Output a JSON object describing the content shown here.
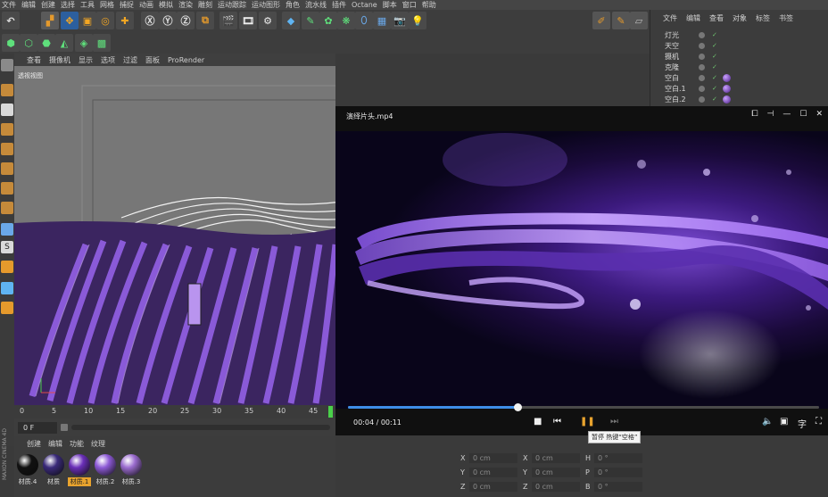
{
  "menu": [
    "文件",
    "编辑",
    "创建",
    "选择",
    "工具",
    "网格",
    "捕捉",
    "动画",
    "模拟",
    "渲染",
    "雕刻",
    "运动跟踪",
    "运动图形",
    "角色",
    "流水线",
    "插件",
    "Octane",
    "脚本",
    "窗口",
    "帮助"
  ],
  "object_manager": {
    "tabs": [
      "文件",
      "编辑",
      "查看",
      "对象",
      "标签",
      "书签"
    ],
    "rows": [
      {
        "name": "灯光"
      },
      {
        "name": "天空"
      },
      {
        "name": "摄机"
      },
      {
        "name": "克隆"
      },
      {
        "name": "空白"
      },
      {
        "name": "空白.1"
      },
      {
        "name": "空白.2"
      }
    ]
  },
  "viewport": {
    "menu": [
      "查看",
      "摄像机",
      "显示",
      "选项",
      "过滤",
      "面板",
      "ProRender"
    ],
    "label": "透视视图"
  },
  "timeline": {
    "ticks": [
      "0",
      "5",
      "10",
      "15",
      "20",
      "25",
      "30",
      "35",
      "40",
      "45"
    ],
    "frame": "0 F"
  },
  "material_manager": {
    "tabs": [
      "创建",
      "编辑",
      "功能",
      "纹理"
    ],
    "materials": [
      {
        "label": "材质.4",
        "color": "#111111"
      },
      {
        "label": "材质",
        "color": "#3a2a7a"
      },
      {
        "label": "材质.1",
        "color": "#6a2fb8",
        "selected": true
      },
      {
        "label": "材质.2",
        "color": "#8d5ad6"
      },
      {
        "label": "材质.3",
        "color": "#9b6ccf"
      }
    ]
  },
  "attributes": {
    "rows": [
      {
        "a": "X",
        "av": "0 cm",
        "b": "X",
        "bv": "0 cm",
        "c": "H",
        "cv": "0 °"
      },
      {
        "a": "Y",
        "av": "0 cm",
        "b": "Y",
        "bv": "0 cm",
        "c": "P",
        "cv": "0 °"
      },
      {
        "a": "Z",
        "av": "0 cm",
        "b": "Z",
        "bv": "0 cm",
        "c": "B",
        "cv": "0 °"
      }
    ]
  },
  "player": {
    "title": "演绎片头.mp4",
    "time": "00:04 / 00:11",
    "progress": 0.36,
    "tooltip": "暂停 热键“空格”",
    "colors": {
      "accent": "#3e8ee8",
      "knob": "#f2f2f2"
    }
  },
  "side_label": "MAXON CINEMA 4D"
}
